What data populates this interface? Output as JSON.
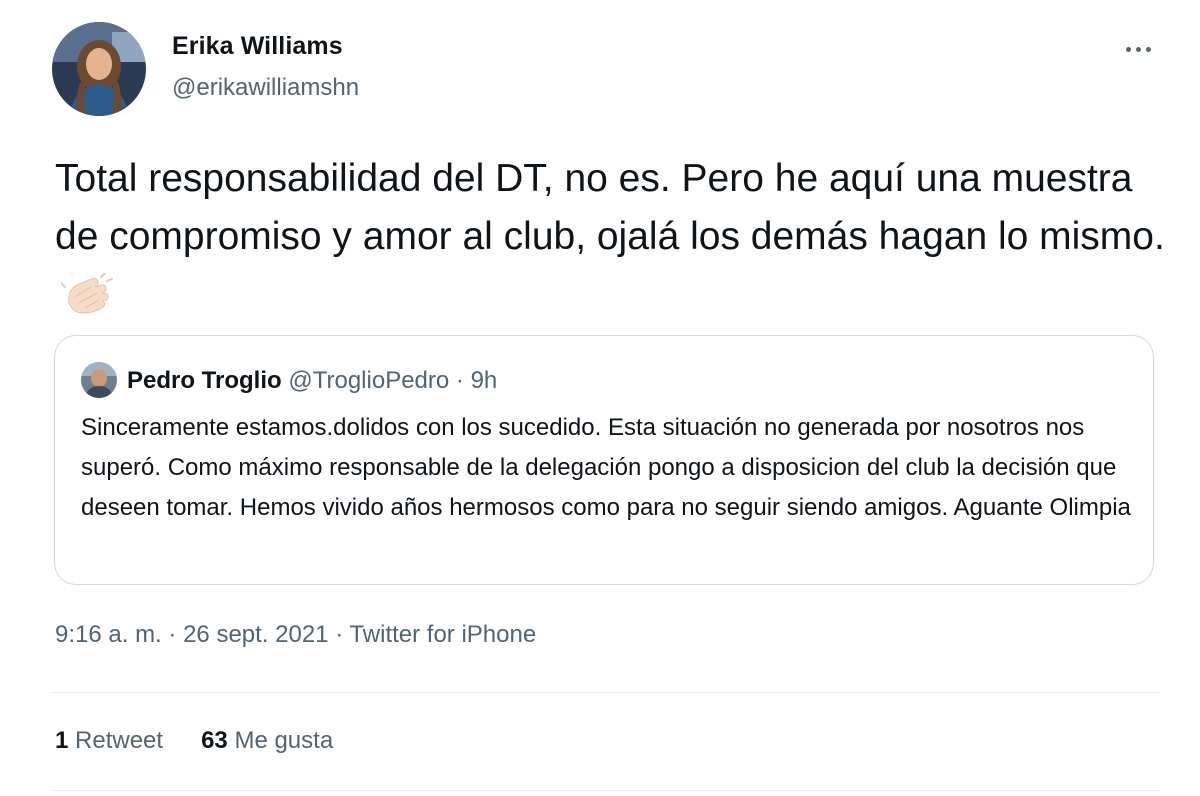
{
  "author": {
    "name": "Erika Williams",
    "handle": "@erikawilliamshn"
  },
  "tweet": {
    "text": "Total responsabilidad del DT, no es. Pero he aquí una muestra de compromiso y amor al club, ojalá los demás hagan lo mismo.",
    "emoji_icon": "clapping-hands-icon"
  },
  "quoted": {
    "name": "Pedro Troglio",
    "handle": "@TroglioPedro",
    "separator": "·",
    "time": "9h",
    "text": "Sinceramente estamos.dolidos con los sucedido. Esta situación no generada por nosotros nos superó. Como máximo responsable de la delegación pongo a disposicion del club la decisión que deseen tomar. Hemos vivido años hermosos como para no seguir siendo amigos. Aguante Olimpia"
  },
  "meta": {
    "time": "9:16 a. m.",
    "sep1": "·",
    "date": "26 sept. 2021",
    "sep2": "·",
    "source": "Twitter for iPhone"
  },
  "stats": {
    "retweets_count": "1",
    "retweets_label": "Retweet",
    "likes_count": "63",
    "likes_label": "Me gusta"
  },
  "colors": {
    "text_primary": "#0f1419",
    "text_secondary": "#536471",
    "border": "#cfd9de"
  }
}
